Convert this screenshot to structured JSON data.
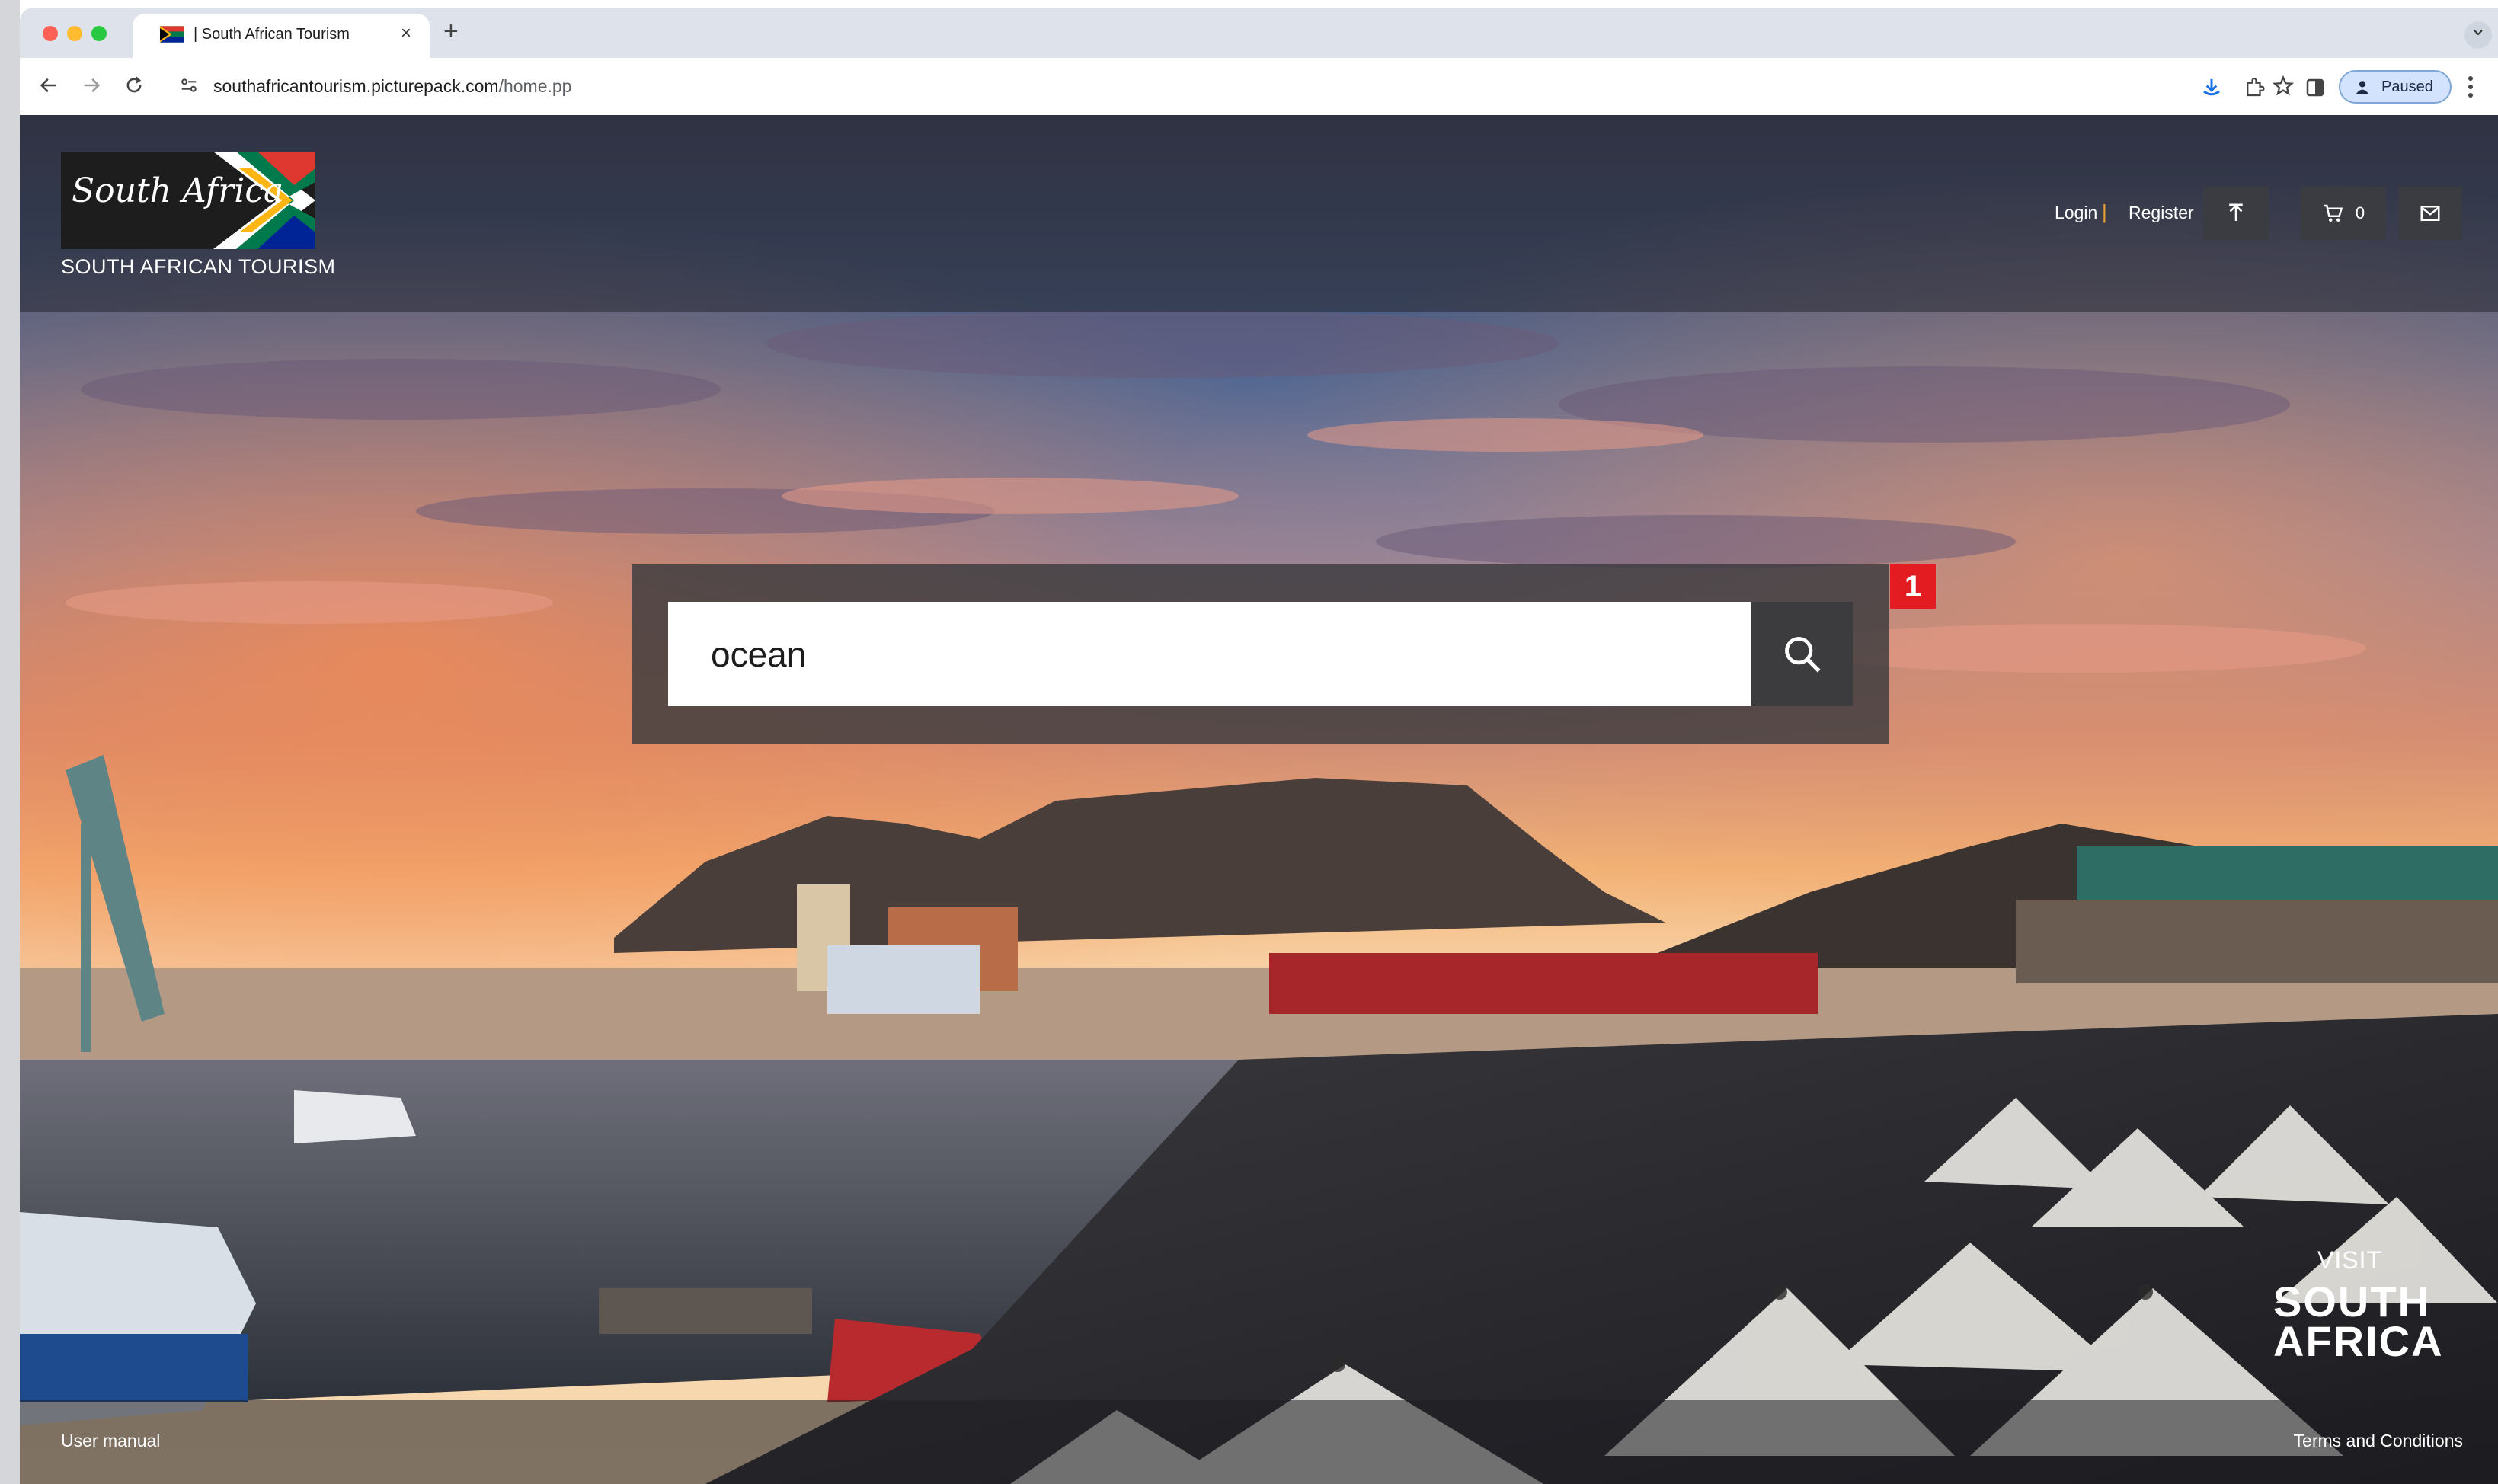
{
  "browser": {
    "tab_title": "| South African Tourism",
    "tab_close": "×",
    "new_tab": "+",
    "url_host": "southafricantourism.picturepack.com",
    "url_path": "/home.pp",
    "profile_status": "Paused",
    "icons": [
      "back-icon",
      "forward-icon",
      "reload-icon",
      "site-info-icon",
      "star-icon",
      "download-icon",
      "extensions-icon",
      "side-panel-icon",
      "profile-icon",
      "menu-icon"
    ]
  },
  "header": {
    "logo_script": "South Africa",
    "logo_subtitle": "SOUTH AFRICAN TOURISM",
    "login_label": "Login",
    "separator": "|",
    "register_label": "Register",
    "cart_count": "0",
    "icons": [
      "upload-icon",
      "cart-icon",
      "mail-icon"
    ]
  },
  "search": {
    "value": "ocean",
    "placeholder": "",
    "badge": "1"
  },
  "brand": {
    "visit_label": "VISIT",
    "south": "SOUTH",
    "africa": "AFRICA"
  },
  "footer": {
    "left_link": "User manual",
    "right_link": "Terms and Conditions"
  },
  "colors": {
    "badge": "#e21c21",
    "separator": "#e7a033",
    "flag_green": "#007a4d",
    "flag_gold": "#ffb612",
    "flag_red": "#de3831",
    "flag_blue": "#002395"
  }
}
